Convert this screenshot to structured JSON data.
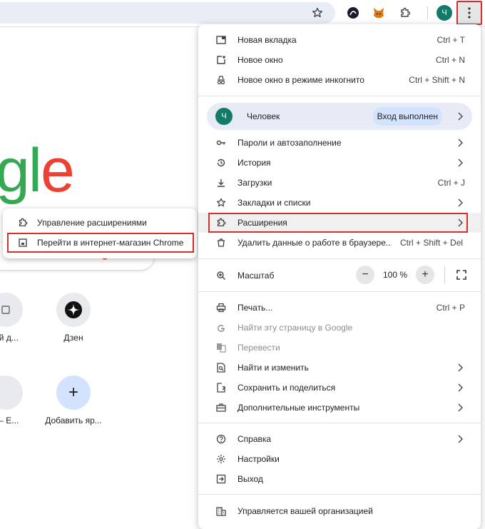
{
  "menu": {
    "new_tab": {
      "label": "Новая вкладка",
      "shortcut": "Ctrl + T"
    },
    "new_window": {
      "label": "Новое окно",
      "shortcut": "Ctrl + N"
    },
    "incognito": {
      "label": "Новое окно в режиме инкогнито",
      "shortcut": "Ctrl + Shift + N"
    },
    "profile": {
      "avatar_letter": "Ч",
      "name": "Человек",
      "badge": "Вход выполнен"
    },
    "passwords": {
      "label": "Пароли и автозаполнение"
    },
    "history": {
      "label": "История"
    },
    "downloads": {
      "label": "Загрузки",
      "shortcut": "Ctrl + J"
    },
    "bookmarks": {
      "label": "Закладки и списки"
    },
    "extensions": {
      "label": "Расширения"
    },
    "clear_data": {
      "label": "Удалить данные о работе в браузере...",
      "shortcut": "Ctrl + Shift + Del"
    },
    "zoom": {
      "label": "Масштаб",
      "value": "100 %",
      "minus": "−",
      "plus": "+"
    },
    "print": {
      "label": "Печать...",
      "shortcut": "Ctrl + P"
    },
    "find_google": {
      "label": "Найти эту страницу в Google"
    },
    "translate": {
      "label": "Перевести"
    },
    "find_edit": {
      "label": "Найти и изменить"
    },
    "save_share": {
      "label": "Сохранить и поделиться"
    },
    "more_tools": {
      "label": "Дополнительные инструменты"
    },
    "help": {
      "label": "Справка"
    },
    "settings": {
      "label": "Настройки"
    },
    "exit": {
      "label": "Выход"
    },
    "managed": {
      "label": "Управляется вашей организацией"
    }
  },
  "submenu": {
    "manage": "Управление расширениями",
    "store": "Перейти в интернет-магазин Chrome"
  },
  "toolbar": {
    "avatar_letter": "Ч"
  },
  "ntp": {
    "logo_g": "g",
    "logo_l": "l",
    "logo_e": "e",
    "shortcuts": [
      {
        "label": "ый д..."
      },
      {
        "label": "Дзен"
      },
      {
        "label": "к – Е..."
      },
      {
        "label": "Добавить яр..."
      }
    ],
    "add_symbol": "+"
  },
  "colors": {
    "accent_red": "#d32f2f",
    "profile_green": "#117b67",
    "profile_bg": "#e7ebf5"
  }
}
